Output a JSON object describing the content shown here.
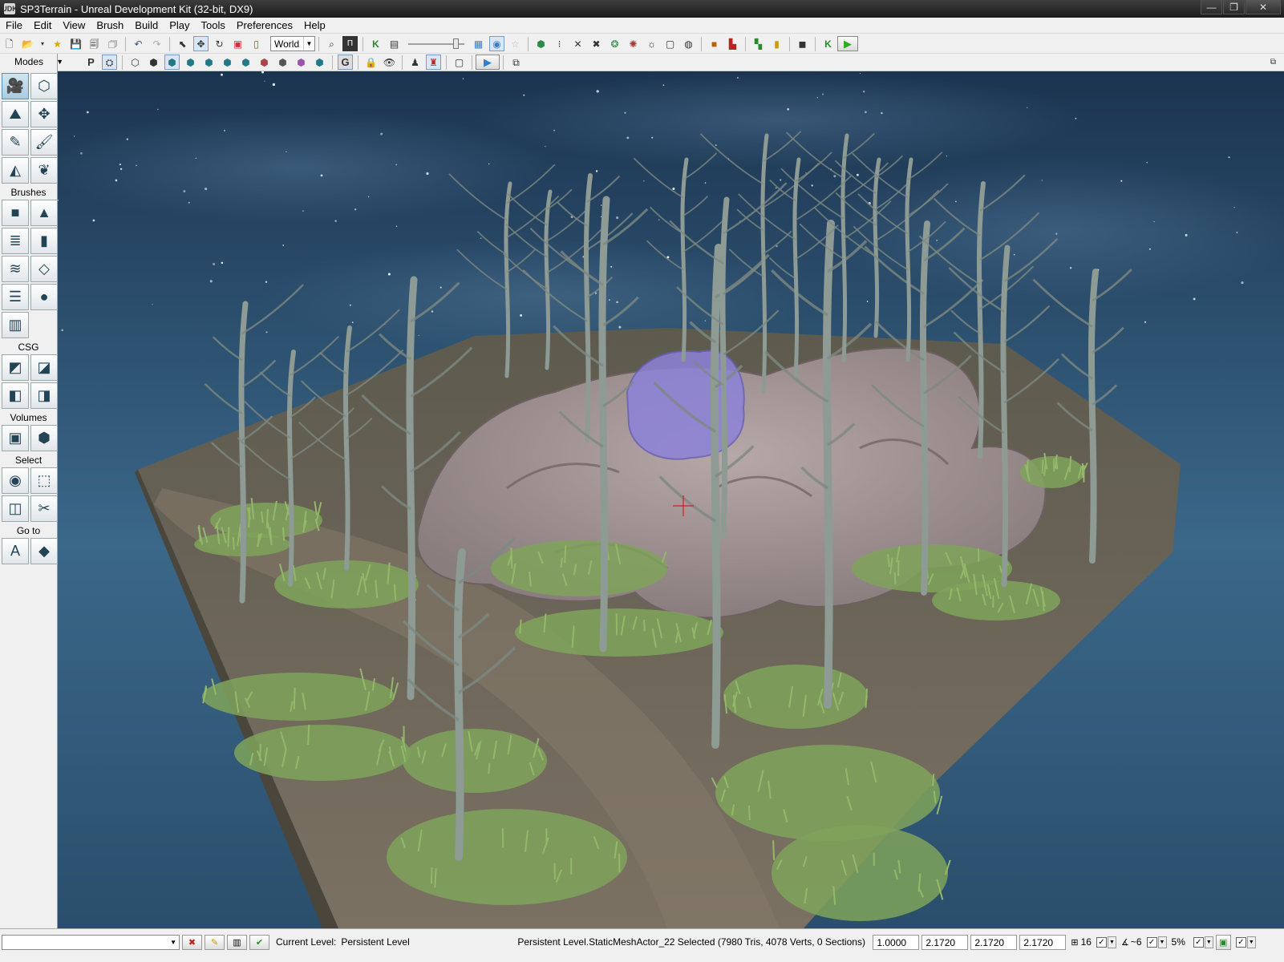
{
  "window": {
    "app_icon_label": "UDK",
    "title": "SP3Terrain - Unreal Development Kit (32-bit, DX9)",
    "minimize": "—",
    "maximize": "❐",
    "close": "✕"
  },
  "menu": [
    "File",
    "Edit",
    "View",
    "Brush",
    "Build",
    "Play",
    "Tools",
    "Preferences",
    "Help"
  ],
  "toolbar": {
    "coord_system": "World",
    "icons_row1": [
      "new-icon",
      "open-icon",
      "favorites-icon",
      "save-icon",
      "save-all-icon",
      "undo-icon",
      "redo-icon",
      "select-icon",
      "translate-icon",
      "rotate-icon",
      "scale-icon",
      "binoculars-icon",
      "play-in-editor-icon"
    ],
    "icons_row2": [
      "viewport-perspective-icon",
      "wireframe-icon",
      "unlit-icon",
      "lit-icon",
      "detail-lighting-icon",
      "lighting-only-icon",
      "light-complexity-icon",
      "texture-density-icon",
      "shader-complexity-icon",
      "lightmap-density-icon",
      "game-view-icon",
      "lock-icon",
      "eye-icon",
      "realtime-icon",
      "matinee-icon",
      "cinematic-icon"
    ],
    "row2_letters": {
      "p": "P",
      "g": "G"
    }
  },
  "modes_panel": {
    "header": "Modes",
    "sections": [
      {
        "label": "",
        "buttons": [
          {
            "name": "camera-mode-icon",
            "glyph": "🎥",
            "active": true
          },
          {
            "name": "geometry-mode-icon",
            "glyph": "⬡",
            "active": false
          },
          {
            "name": "terrain-mode-icon",
            "glyph": "⛰",
            "active": false
          },
          {
            "name": "move-mode-icon",
            "glyph": "✥",
            "active": false
          },
          {
            "name": "texture-align-icon",
            "glyph": "✎",
            "active": false
          },
          {
            "name": "mesh-paint-icon",
            "glyph": "🖌",
            "active": false
          },
          {
            "name": "landscape-mode-icon",
            "glyph": "◭",
            "active": false
          },
          {
            "name": "foliage-mode-icon",
            "glyph": "❦",
            "active": false
          }
        ]
      },
      {
        "label": "Brushes",
        "buttons": [
          {
            "name": "cube-brush-icon",
            "glyph": "■",
            "active": false
          },
          {
            "name": "cone-brush-icon",
            "glyph": "▲",
            "active": false
          },
          {
            "name": "linear-stairs-icon",
            "glyph": "≣",
            "active": false
          },
          {
            "name": "cylinder-brush-icon",
            "glyph": "▮",
            "active": false
          },
          {
            "name": "curved-stairs-icon",
            "glyph": "≋",
            "active": false
          },
          {
            "name": "sheet-brush-icon",
            "glyph": "◇",
            "active": false
          },
          {
            "name": "spiral-stairs-icon",
            "glyph": "☰",
            "active": false
          },
          {
            "name": "sphere-brush-icon",
            "glyph": "●",
            "active": false
          },
          {
            "name": "volumetric-brush-icon",
            "glyph": "▥",
            "active": false
          }
        ]
      },
      {
        "label": "CSG",
        "buttons": [
          {
            "name": "csg-add-icon",
            "glyph": "◩",
            "active": false
          },
          {
            "name": "csg-subtract-icon",
            "glyph": "◪",
            "active": false
          },
          {
            "name": "csg-intersect-icon",
            "glyph": "◧",
            "active": false
          },
          {
            "name": "csg-deintersect-icon",
            "glyph": "◨",
            "active": false
          }
        ]
      },
      {
        "label": "Volumes",
        "buttons": [
          {
            "name": "add-volume-icon",
            "glyph": "▣",
            "active": false
          },
          {
            "name": "volume-menu-icon",
            "glyph": "⬢",
            "active": false
          }
        ]
      },
      {
        "label": "Select",
        "buttons": [
          {
            "name": "show-selected-icon",
            "glyph": "◉",
            "active": false
          },
          {
            "name": "hide-selected-icon",
            "glyph": "⬚",
            "active": false
          },
          {
            "name": "invert-selection-icon",
            "glyph": "◫",
            "active": false
          },
          {
            "name": "show-all-icon",
            "glyph": "✂",
            "active": false
          }
        ]
      },
      {
        "label": "Go to",
        "buttons": [
          {
            "name": "go-to-actor-icon",
            "glyph": "A",
            "active": false
          },
          {
            "name": "go-to-builder-brush-icon",
            "glyph": "◆",
            "active": false
          }
        ]
      }
    ]
  },
  "statusbar": {
    "current_level_label": "Current Level:",
    "current_level_value": "Persistent Level",
    "selection_info": "Persistent Level.StaticMeshActor_22 Selected (7980 Tris, 4078 Verts, 0 Sections)",
    "drag_scale": "1.0000",
    "scale_x": "2.1720",
    "scale_y": "2.1720",
    "scale_z": "2.1720",
    "grid_snap": "16",
    "rotation_snap": "~6",
    "scale_snap": "5%"
  },
  "colors": {
    "sky_top": "#1b3450",
    "sky_bottom": "#3b6788",
    "terrain": "#6e6659",
    "rock": "#a59696",
    "grass": "#7fa35a",
    "selected_actor": "#8c82d8"
  }
}
